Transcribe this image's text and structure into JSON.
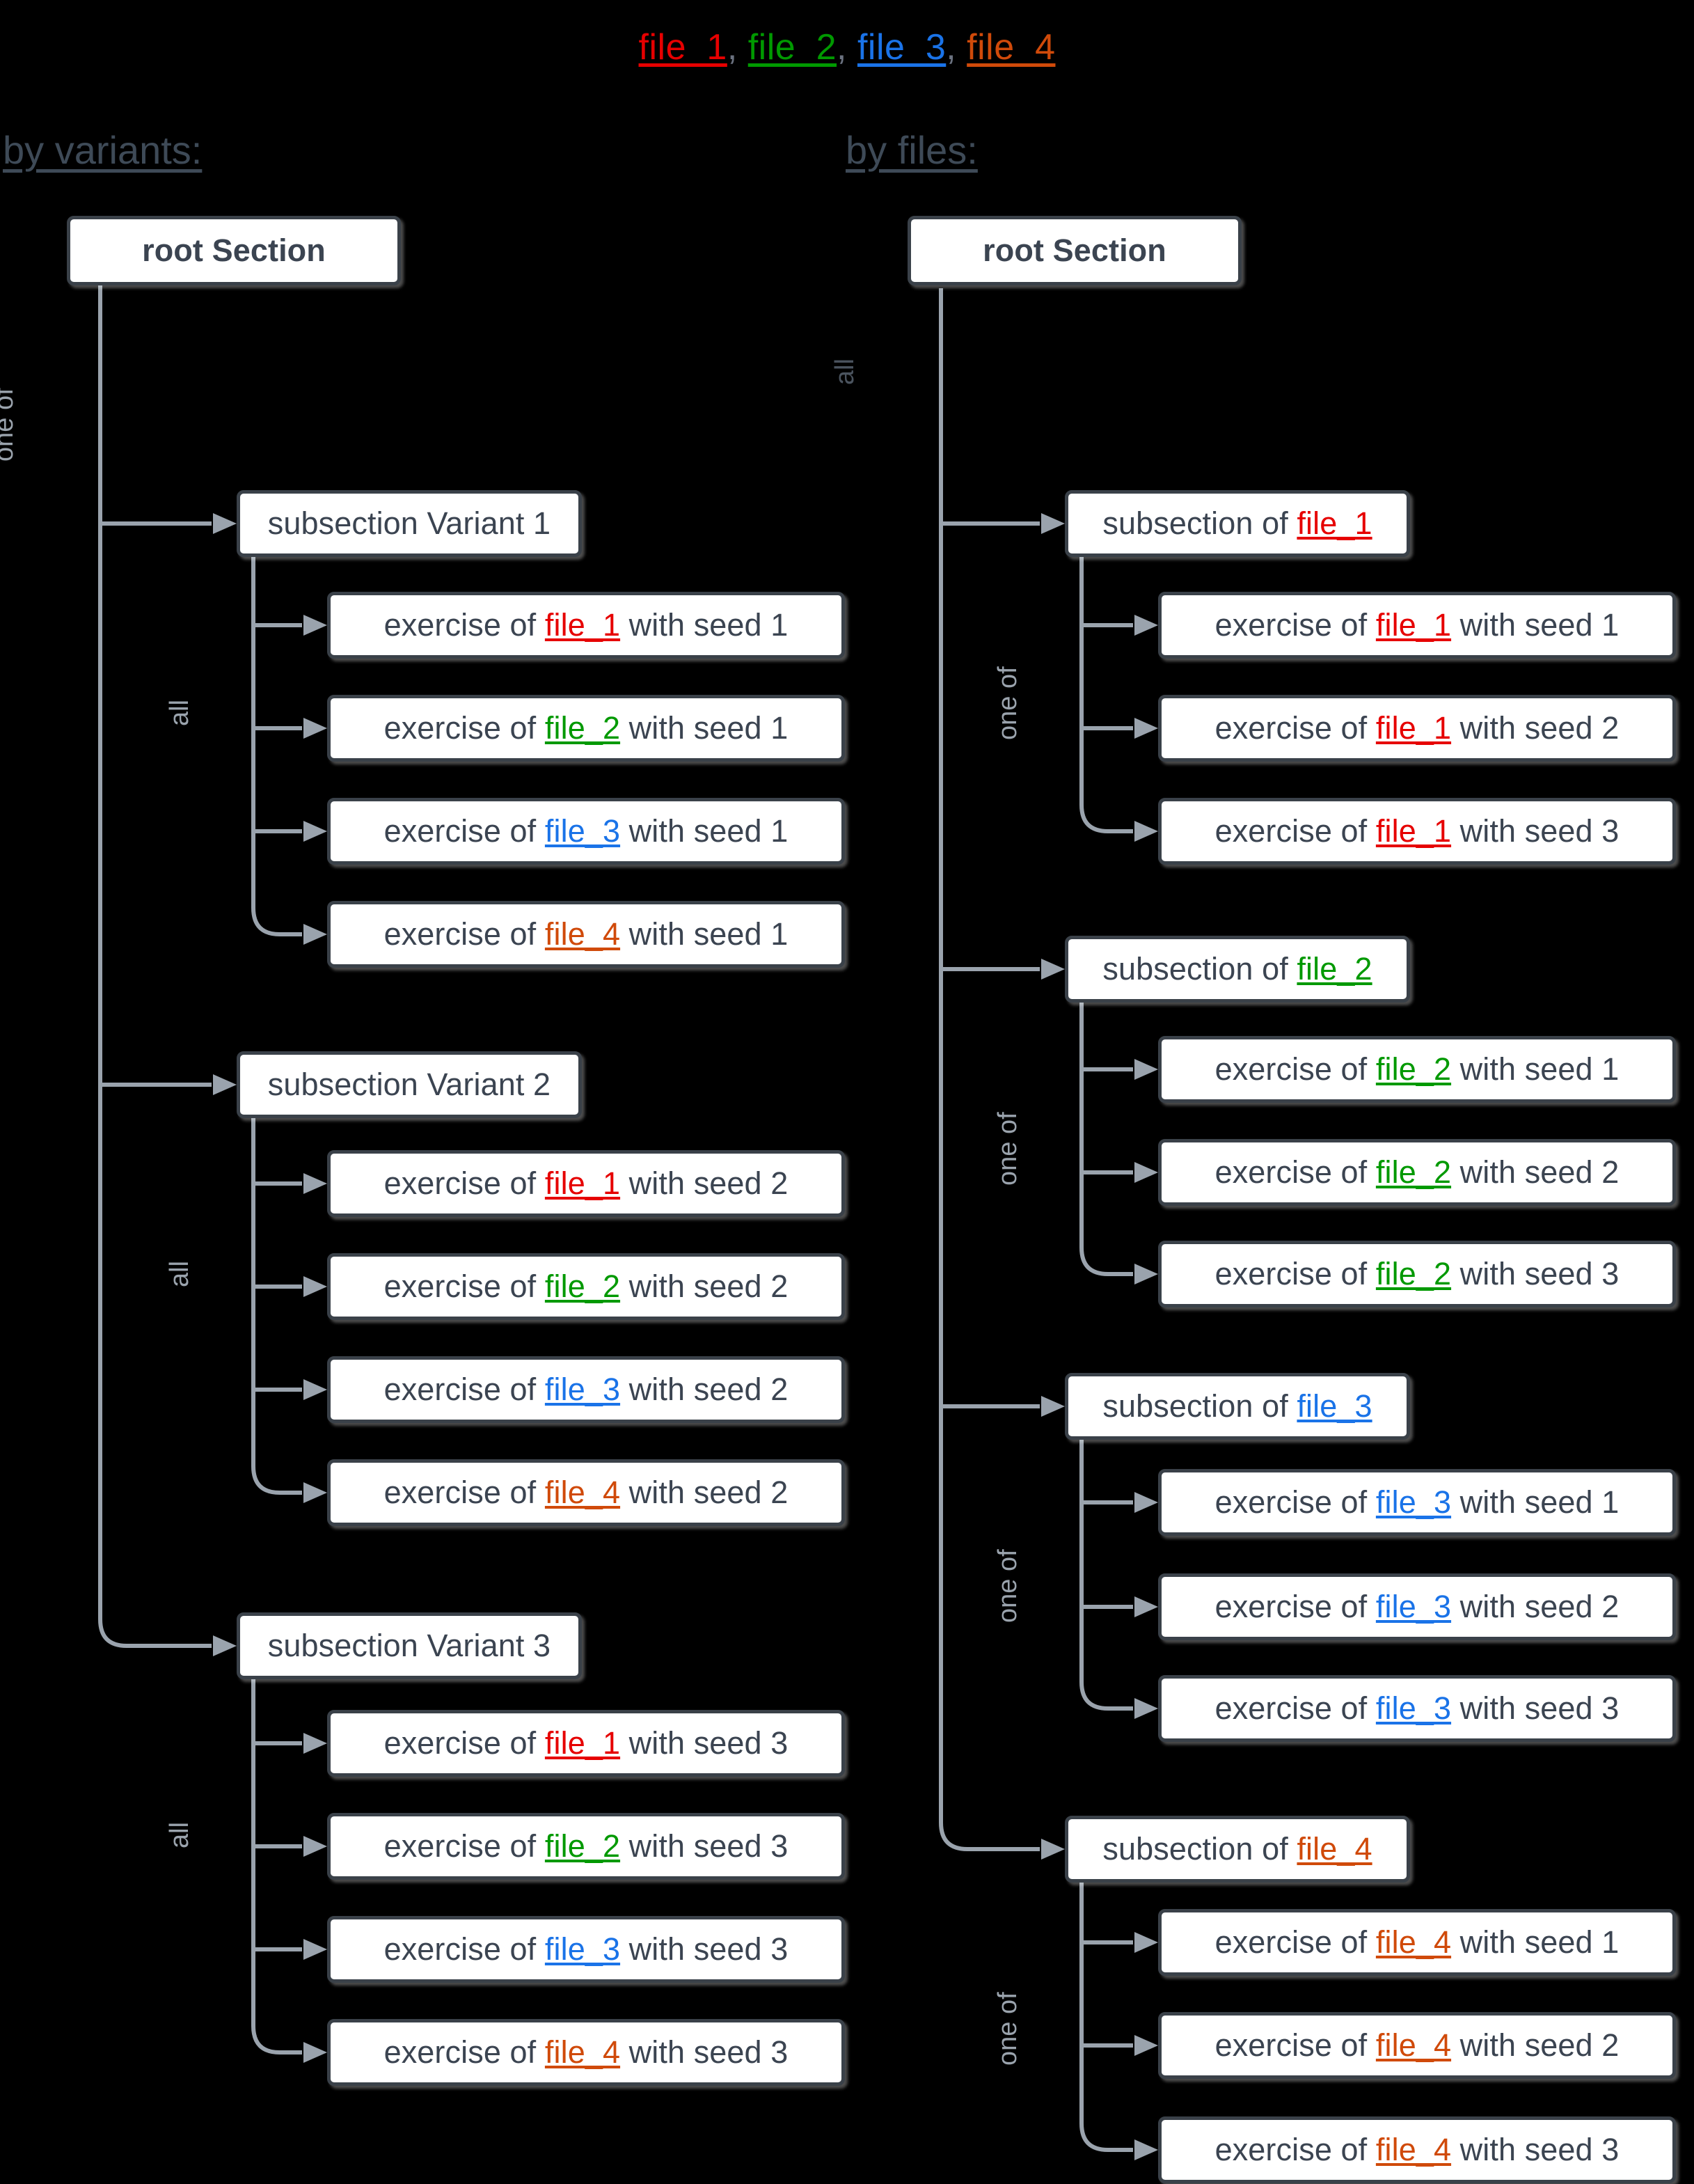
{
  "legend": {
    "files": [
      {
        "name": "file_1",
        "color": "#e60000",
        "cls": "f1"
      },
      {
        "name": "file_2",
        "color": "#009900",
        "cls": "f2"
      },
      {
        "name": "file_3",
        "color": "#1a73e8",
        "cls": "f3"
      },
      {
        "name": "file_4",
        "color": "#d04a0a",
        "cls": "f4"
      }
    ],
    "separator": ", "
  },
  "theme": {
    "background": "#000000",
    "box_fill": "#ffffff",
    "box_border": "#3a4149",
    "text": "#3b4451",
    "edge": "#9aa3ad",
    "header_text": "#3e4a57",
    "file_1": "#e60000",
    "file_2": "#009900",
    "file_3": "#1a73e8",
    "file_4": "#d04a0a"
  },
  "columns": {
    "left": {
      "header": "by variants:",
      "root": "root Section",
      "root_edge_label": "one of",
      "child_edge_label": "all",
      "groups": [
        {
          "title_prefix": "subsection Variant ",
          "title_suffix": "1",
          "title": "subsection Variant 1",
          "edge_label": "all",
          "children": [
            {
              "pre": "exercise of ",
              "file": "file_1",
              "file_cls": "f1",
              "post": " with seed 1"
            },
            {
              "pre": "exercise of ",
              "file": "file_2",
              "file_cls": "f2",
              "post": " with seed 1"
            },
            {
              "pre": "exercise of ",
              "file": "file_3",
              "file_cls": "f3",
              "post": " with seed 1"
            },
            {
              "pre": "exercise of ",
              "file": "file_4",
              "file_cls": "f4",
              "post": " with seed 1"
            }
          ]
        },
        {
          "title": "subsection Variant 2",
          "edge_label": "all",
          "children": [
            {
              "pre": "exercise of ",
              "file": "file_1",
              "file_cls": "f1",
              "post": " with seed 2"
            },
            {
              "pre": "exercise of ",
              "file": "file_2",
              "file_cls": "f2",
              "post": " with seed 2"
            },
            {
              "pre": "exercise of ",
              "file": "file_3",
              "file_cls": "f3",
              "post": " with seed 2"
            },
            {
              "pre": "exercise of ",
              "file": "file_4",
              "file_cls": "f4",
              "post": " with seed 2"
            }
          ]
        },
        {
          "title": "subsection Variant 3",
          "edge_label": "all",
          "children": [
            {
              "pre": "exercise of ",
              "file": "file_1",
              "file_cls": "f1",
              "post": " with seed 3"
            },
            {
              "pre": "exercise of ",
              "file": "file_2",
              "file_cls": "f2",
              "post": " with seed 3"
            },
            {
              "pre": "exercise of ",
              "file": "file_3",
              "file_cls": "f3",
              "post": " with seed 3"
            },
            {
              "pre": "exercise of ",
              "file": "file_4",
              "file_cls": "f4",
              "post": " with seed 3"
            }
          ]
        }
      ]
    },
    "right": {
      "header": "by files:",
      "root": "root Section",
      "root_edge_label": "all",
      "child_edge_label": "one of",
      "groups": [
        {
          "title_pre": "subsection of ",
          "title_file": "file_1",
          "title_file_cls": "f1",
          "edge_label": "one of",
          "children": [
            {
              "pre": "exercise of ",
              "file": "file_1",
              "file_cls": "f1",
              "post": " with seed 1"
            },
            {
              "pre": "exercise of ",
              "file": "file_1",
              "file_cls": "f1",
              "post": " with seed 2"
            },
            {
              "pre": "exercise of ",
              "file": "file_1",
              "file_cls": "f1",
              "post": " with seed 3"
            }
          ]
        },
        {
          "title_pre": "subsection of ",
          "title_file": "file_2",
          "title_file_cls": "f2",
          "edge_label": "one of",
          "children": [
            {
              "pre": "exercise of ",
              "file": "file_2",
              "file_cls": "f2",
              "post": " with seed 1"
            },
            {
              "pre": "exercise of ",
              "file": "file_2",
              "file_cls": "f2",
              "post": " with seed 2"
            },
            {
              "pre": "exercise of ",
              "file": "file_2",
              "file_cls": "f2",
              "post": " with seed 3"
            }
          ]
        },
        {
          "title_pre": "subsection of ",
          "title_file": "file_3",
          "title_file_cls": "f3",
          "edge_label": "one of",
          "children": [
            {
              "pre": "exercise of ",
              "file": "file_3",
              "file_cls": "f3",
              "post": " with seed 1"
            },
            {
              "pre": "exercise of ",
              "file": "file_3",
              "file_cls": "f3",
              "post": " with seed 2"
            },
            {
              "pre": "exercise of ",
              "file": "file_3",
              "file_cls": "f3",
              "post": " with seed 3"
            }
          ]
        },
        {
          "title_pre": "subsection of ",
          "title_file": "file_4",
          "title_file_cls": "f4",
          "edge_label": "one of",
          "children": [
            {
              "pre": "exercise of ",
              "file": "file_4",
              "file_cls": "f4",
              "post": " with seed 1"
            },
            {
              "pre": "exercise of ",
              "file": "file_4",
              "file_cls": "f4",
              "post": " with seed 2"
            },
            {
              "pre": "exercise of ",
              "file": "file_4",
              "file_cls": "f4",
              "post": " with seed 3"
            }
          ]
        }
      ]
    }
  }
}
